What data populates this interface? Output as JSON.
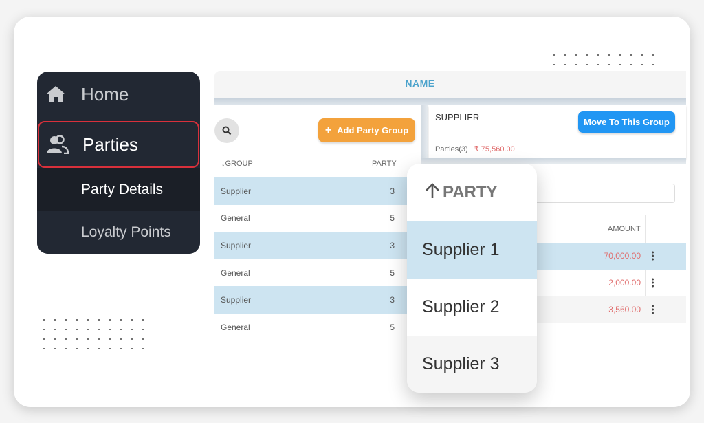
{
  "sidebar": {
    "items": [
      {
        "label": "Home",
        "icon": "home-icon"
      },
      {
        "label": "Parties",
        "icon": "users-icon",
        "active": true
      },
      {
        "label": "Party Details"
      },
      {
        "label": "Loyalty Points"
      }
    ]
  },
  "tabs": {
    "active_label": "NAME"
  },
  "group_panel": {
    "add_button_label": "Add Party Group",
    "columns": {
      "group": "GROUP",
      "party": "PARTY"
    },
    "rows": [
      {
        "group": "Supplier",
        "party": "3",
        "selected": true
      },
      {
        "group": "General",
        "party": "5",
        "selected": false
      },
      {
        "group": "Supplier",
        "party": "3",
        "selected": true
      },
      {
        "group": "General",
        "party": "5",
        "selected": false
      },
      {
        "group": "Supplier",
        "party": "3",
        "selected": true
      },
      {
        "group": "General",
        "party": "5",
        "selected": false
      }
    ]
  },
  "supplier_card": {
    "title": "SUPPLIER",
    "parties_label": "Parties(3)",
    "total_amount": "₹ 75,560.00",
    "move_button_label": "Move To This Group"
  },
  "party_table": {
    "amount_header": "AMOUNT",
    "rows": [
      {
        "party": "Supplier 1",
        "amount": "70,000.00"
      },
      {
        "party": "Supplier 2",
        "amount": "2,000.00"
      },
      {
        "party": "Supplier 3",
        "amount": "3,560.00"
      }
    ]
  },
  "popup": {
    "header": "PARTY",
    "sort_icon": "arrow-up-icon"
  },
  "colors": {
    "sidebar_bg": "#222833",
    "active_border": "#d9303b",
    "add_button": "#f3a23c",
    "move_button": "#2196f3",
    "selected_row": "#cde4f1",
    "amount_text": "#e06c6c",
    "tab_text": "#4ca3cc"
  }
}
